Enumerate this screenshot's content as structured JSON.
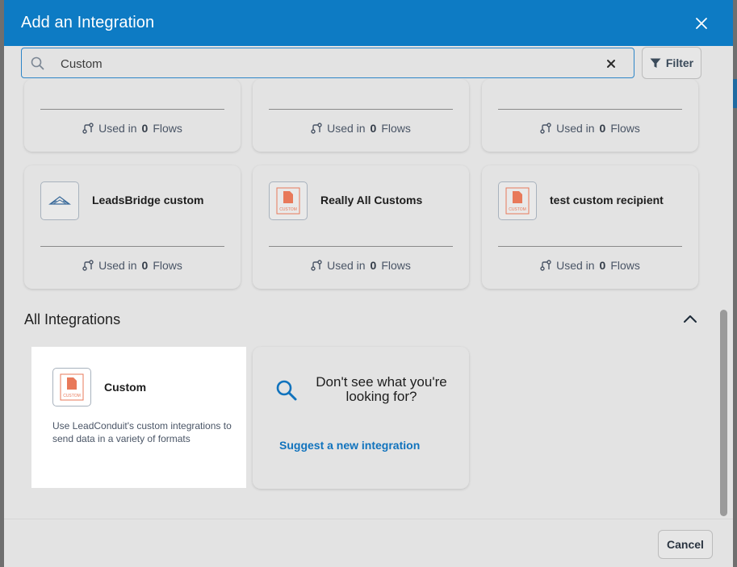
{
  "modal": {
    "title": "Add an Integration",
    "header_color": "#0d7bc4"
  },
  "search": {
    "value": "Custom",
    "filter_label": "Filter"
  },
  "usage": {
    "prefix": "Used in",
    "suffix": "Flows"
  },
  "top_partial_cards": [
    {
      "count": "0"
    },
    {
      "count": "0"
    },
    {
      "count": "0"
    }
  ],
  "custom_cards": [
    {
      "name": "LeadsBridge custom",
      "icon": "leadsbridge-icon",
      "count": "0"
    },
    {
      "name": "Really All Customs",
      "icon": "custom-doc-icon",
      "count": "0"
    },
    {
      "name": "test custom recipient",
      "icon": "custom-doc-icon",
      "count": "0"
    }
  ],
  "all_integrations": {
    "title": "All Integrations",
    "custom": {
      "name": "Custom",
      "description": "Use LeadConduit's custom integrations to send data in a variety of formats",
      "icon_label": "CUSTOM"
    },
    "suggest": {
      "text": "Don't see what you're looking for?",
      "link": "Suggest a new integration"
    }
  },
  "footer": {
    "cancel_label": "Cancel"
  },
  "icon_badge_label": "CUSTOM",
  "colors": {
    "accent": "#0d7bc4",
    "link": "#1173bd",
    "custom_icon": "#e8795a"
  }
}
